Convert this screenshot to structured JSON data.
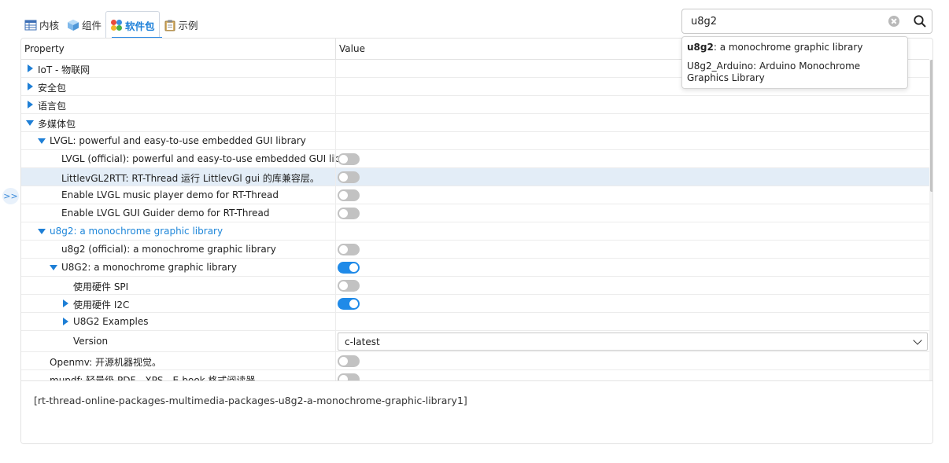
{
  "tabs": [
    {
      "label": "内核",
      "icon": "table-icon"
    },
    {
      "label": "组件",
      "icon": "cube-icon"
    },
    {
      "label": "软件包",
      "icon": "package-icon"
    },
    {
      "label": "示例",
      "icon": "clipboard-icon"
    }
  ],
  "search": {
    "value": "u8g2"
  },
  "suggestions": {
    "first_bold": "u8g2",
    "first_rest": ": a monochrome graphic library",
    "second": "U8g2_Arduino: Arduino Monochrome Graphics Library"
  },
  "grid": {
    "col_property": "Property",
    "col_value": "Value"
  },
  "rows": {
    "iot": "IoT - 物联网",
    "security": "安全包",
    "language": "语言包",
    "multimedia": "多媒体包",
    "lvgl": "LVGL: powerful and easy-to-use embedded GUI library",
    "lvgl_official": "LVGL (official): powerful and easy-to-use embedded GUI library",
    "littlevgl2rtt": "LittlevGL2RTT: RT-Thread 运行 LittlevGl gui 的库兼容层。",
    "lvgl_music": "Enable LVGL music player demo for RT-Thread",
    "lvgl_guider": "Enable LVGL GUI Guider demo for RT-Thread",
    "u8g2": "u8g2: a monochrome graphic library",
    "u8g2_official": "u8g2 (official): a monochrome graphic library",
    "u8g2_lib": "U8G2: a monochrome graphic library",
    "hw_spi": "使用硬件 SPI",
    "hw_i2c": "使用硬件 I2C",
    "u8g2_examples": "U8G2 Examples",
    "version_label": "Version",
    "version_value": "c-latest",
    "openmv": "Openmv: 开源机器视觉。",
    "mupdf": "mupdf: 轻量级 PDF、XPS、E-book 格式阅读器"
  },
  "toggles": {
    "lvgl_official": false,
    "littlevgl2rtt": false,
    "lvgl_music": false,
    "lvgl_guider": false,
    "u8g2_official": false,
    "u8g2_lib": true,
    "hw_spi": false,
    "hw_i2c": true,
    "openmv": false,
    "mupdf": false
  },
  "description": "[rt-thread-online-packages-multimedia-packages-u8g2-a-monochrome-graphic-library1]",
  "colors": {
    "accent": "#1f8ae8",
    "selected_row": "#e3edf7"
  }
}
